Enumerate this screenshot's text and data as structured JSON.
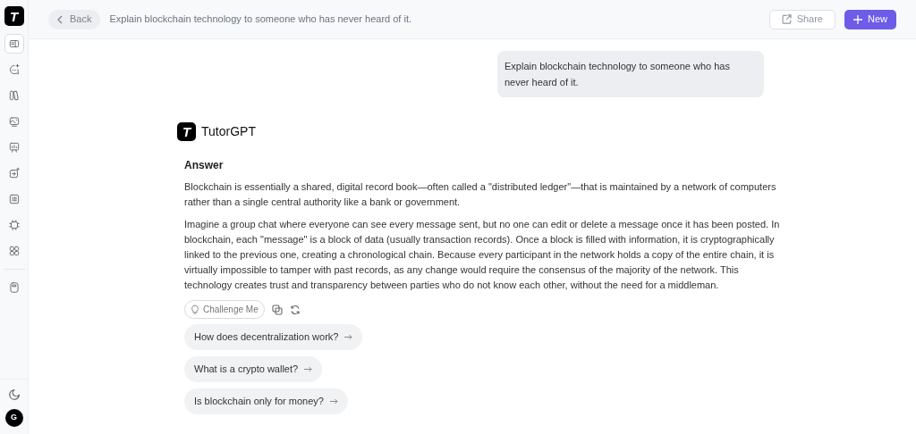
{
  "sidebar": {
    "logo": "T",
    "items": [
      {
        "kind": "panel",
        "selected": true
      },
      {
        "kind": "chat-plus",
        "selected": false
      },
      {
        "kind": "books",
        "selected": false
      },
      {
        "kind": "image",
        "selected": false
      },
      {
        "kind": "board",
        "selected": false
      },
      {
        "kind": "edit",
        "selected": false
      },
      {
        "kind": "list",
        "selected": false
      },
      {
        "kind": "chip",
        "selected": false
      },
      {
        "kind": "grid",
        "selected": false
      },
      {
        "kind": "device",
        "selected": false
      }
    ],
    "avatar": "G"
  },
  "header": {
    "back": "Back",
    "title": "Explain blockchain technology to someone who has never heard of it.",
    "share": "Share",
    "new": "New"
  },
  "user_message": "Explain blockchain technology to someone who has never heard of it.",
  "assistant": {
    "logo": "T",
    "name": "TutorGPT",
    "heading": "Answer",
    "paragraphs": [
      "Blockchain is essentially a shared, digital record book—often called a \"distributed ledger\"—that is maintained by a network of computers rather than a single central authority like a bank or government.",
      "Imagine a group chat where everyone can see every message sent, but no one can edit or delete a message once it has been posted. In blockchain, each \"message\" is a block of data (usually transaction records). Once a block is filled with information, it is cryptographically linked to the previous one, creating a chronological chain. Because every participant in the network holds a copy of the entire chain, it is virtually impossible to tamper with past records, as any change would require the consensus of the majority of the network. This technology creates trust and transparency between parties who do not know each other, without the need for a middleman."
    ],
    "challenge": "Challenge Me",
    "suggestions": [
      "How does decentralization work?",
      "What is a crypto wallet?",
      "Is blockchain only for money?"
    ]
  }
}
